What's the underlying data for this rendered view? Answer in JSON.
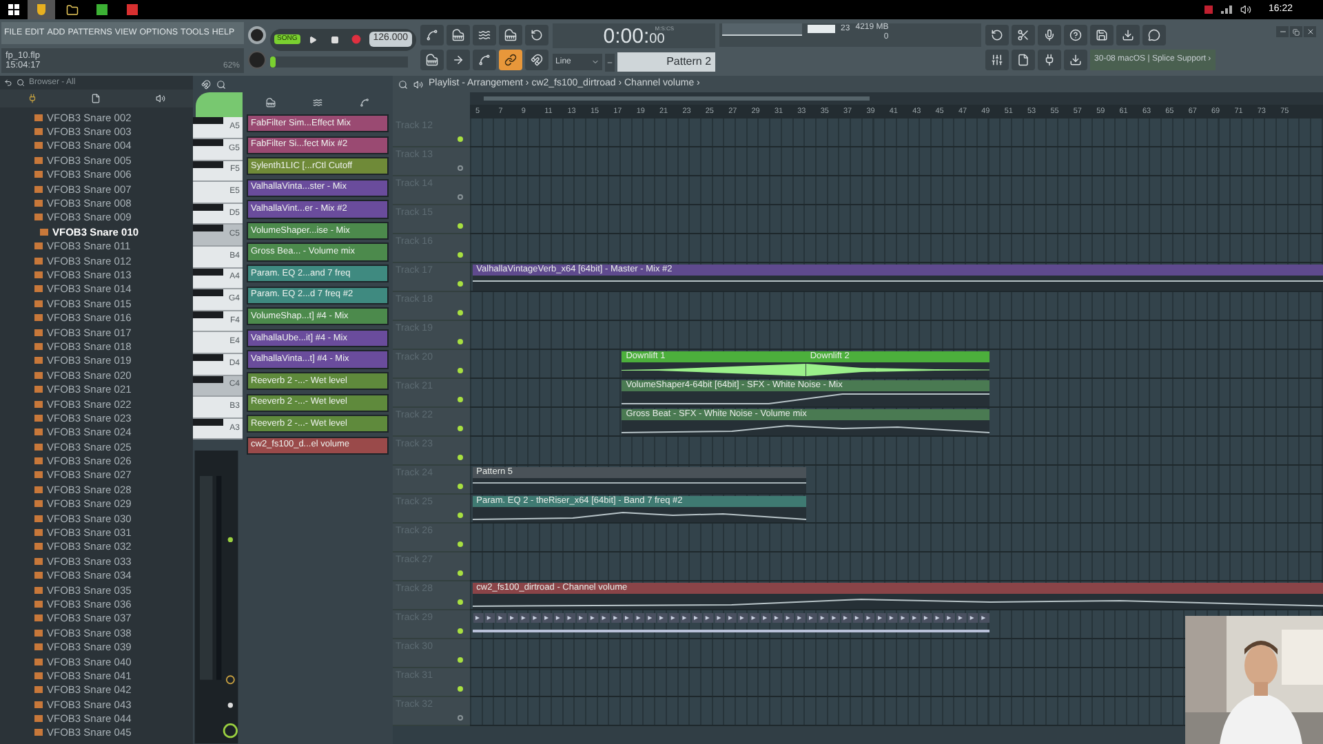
{
  "taskbar": {
    "clock": "16:22"
  },
  "menu": [
    "FILE",
    "EDIT",
    "ADD",
    "PATTERNS",
    "VIEW",
    "OPTIONS",
    "TOOLS",
    "HELP"
  ],
  "project": {
    "file": "fp_10.flp",
    "time": "15:04:17",
    "zoom": "62%"
  },
  "transport": {
    "mode": "SONG",
    "tempo": "126.000",
    "position": {
      "level": 0
    }
  },
  "clock_display": {
    "main": "0:00:",
    "sub": "00",
    "unit": "M:S:CS"
  },
  "monitor": {
    "cpu": "23",
    "memory": "4219 MB",
    "polyphony": "0"
  },
  "snap": "Line",
  "pattern": "Pattern 2",
  "news": "30-08  macOS | Splice Support ›",
  "browser": {
    "title": "Browser - All",
    "items": [
      {
        "label": "VFOB3 Snare 002",
        "selected": false
      },
      {
        "label": "VFOB3 Snare 003",
        "selected": false
      },
      {
        "label": "VFOB3 Snare 004",
        "selected": false
      },
      {
        "label": "VFOB3 Snare 005",
        "selected": false
      },
      {
        "label": "VFOB3 Snare 006",
        "selected": false
      },
      {
        "label": "VFOB3 Snare 007",
        "selected": false
      },
      {
        "label": "VFOB3 Snare 008",
        "selected": false
      },
      {
        "label": "VFOB3 Snare 009",
        "selected": false
      },
      {
        "label": "VFOB3 Snare 010",
        "selected": true
      },
      {
        "label": "VFOB3 Snare 011",
        "selected": false
      },
      {
        "label": "VFOB3 Snare 012",
        "selected": false
      },
      {
        "label": "VFOB3 Snare 013",
        "selected": false
      },
      {
        "label": "VFOB3 Snare 014",
        "selected": false
      },
      {
        "label": "VFOB3 Snare 015",
        "selected": false
      },
      {
        "label": "VFOB3 Snare 016",
        "selected": false
      },
      {
        "label": "VFOB3 Snare 017",
        "selected": false
      },
      {
        "label": "VFOB3 Snare 018",
        "selected": false
      },
      {
        "label": "VFOB3 Snare 019",
        "selected": false
      },
      {
        "label": "VFOB3 Snare 020",
        "selected": false
      },
      {
        "label": "VFOB3 Snare 021",
        "selected": false
      },
      {
        "label": "VFOB3 Snare 022",
        "selected": false
      },
      {
        "label": "VFOB3 Snare 023",
        "selected": false
      },
      {
        "label": "VFOB3 Snare 024",
        "selected": false
      },
      {
        "label": "VFOB3 Snare 025",
        "selected": false
      },
      {
        "label": "VFOB3 Snare 026",
        "selected": false
      },
      {
        "label": "VFOB3 Snare 027",
        "selected": false
      },
      {
        "label": "VFOB3 Snare 028",
        "selected": false
      },
      {
        "label": "VFOB3 Snare 029",
        "selected": false
      },
      {
        "label": "VFOB3 Snare 030",
        "selected": false
      },
      {
        "label": "VFOB3 Snare 031",
        "selected": false
      },
      {
        "label": "VFOB3 Snare 032",
        "selected": false
      },
      {
        "label": "VFOB3 Snare 033",
        "selected": false
      },
      {
        "label": "VFOB3 Snare 034",
        "selected": false
      },
      {
        "label": "VFOB3 Snare 035",
        "selected": false
      },
      {
        "label": "VFOB3 Snare 036",
        "selected": false
      },
      {
        "label": "VFOB3 Snare 037",
        "selected": false
      },
      {
        "label": "VFOB3 Snare 038",
        "selected": false
      },
      {
        "label": "VFOB3 Snare 039",
        "selected": false
      },
      {
        "label": "VFOB3 Snare 040",
        "selected": false
      },
      {
        "label": "VFOB3 Snare 041",
        "selected": false
      },
      {
        "label": "VFOB3 Snare 042",
        "selected": false
      },
      {
        "label": "VFOB3 Snare 043",
        "selected": false
      },
      {
        "label": "VFOB3 Snare 044",
        "selected": false
      },
      {
        "label": "VFOB3 Snare 045",
        "selected": false
      }
    ]
  },
  "piano_keys": [
    {
      "label": "A5",
      "sharp": true,
      "highlighted": false
    },
    {
      "label": "G5",
      "sharp": true,
      "highlighted": false
    },
    {
      "label": "F5",
      "sharp": true,
      "highlighted": false
    },
    {
      "label": "E5",
      "sharp": false,
      "highlighted": false
    },
    {
      "label": "D5",
      "sharp": true,
      "highlighted": false
    },
    {
      "label": "C5",
      "sharp": true,
      "highlighted": true
    },
    {
      "label": "B4",
      "sharp": false,
      "highlighted": false
    },
    {
      "label": "A4",
      "sharp": true,
      "highlighted": false
    },
    {
      "label": "G4",
      "sharp": true,
      "highlighted": false
    },
    {
      "label": "F4",
      "sharp": true,
      "highlighted": false
    },
    {
      "label": "E4",
      "sharp": false,
      "highlighted": false
    },
    {
      "label": "D4",
      "sharp": true,
      "highlighted": false
    },
    {
      "label": "C4",
      "sharp": true,
      "highlighted": true
    },
    {
      "label": "B3",
      "sharp": false,
      "highlighted": false
    },
    {
      "label": "A3",
      "sharp": true,
      "highlighted": false
    }
  ],
  "channels": [
    {
      "label": "FabFilter Sim...Effect Mix",
      "color": "#9a4a72"
    },
    {
      "label": "FabFilter Si...fect Mix #2",
      "color": "#9a4a72"
    },
    {
      "label": "Sylenth1LIC [...rCtl Cutoff",
      "color": "#6f8a38"
    },
    {
      "label": "ValhallaVinta...ster - Mix",
      "color": "#6a4c9c"
    },
    {
      "label": "ValhallaVint...er - Mix #2",
      "color": "#6a4c9c"
    },
    {
      "label": "VolumeShaper...ise - Mix",
      "color": "#4c8a4c"
    },
    {
      "label": "Gross Bea... - Volume mix",
      "color": "#4c8a4c"
    },
    {
      "label": "Param. EQ 2...and 7 freq",
      "color": "#3f8a80"
    },
    {
      "label": "Param. EQ 2...d 7 freq #2",
      "color": "#3f8a80"
    },
    {
      "label": "VolumeShap...t] #4 - Mix",
      "color": "#4c8a4c"
    },
    {
      "label": "ValhallaUbe...it] #4 - Mix",
      "color": "#6a4c9c"
    },
    {
      "label": "ValhallaVinta...t] #4 - Mix",
      "color": "#6a4c9c"
    },
    {
      "label": "Reeverb 2 -...- Wet level",
      "color": "#5f8a3c"
    },
    {
      "label": "Reeverb 2 -...- Wet level",
      "color": "#5f8a3c"
    },
    {
      "label": "Reeverb 2 -...- Wet level",
      "color": "#5f8a3c"
    },
    {
      "label": "cw2_fs100_d...el volume",
      "color": "#9a4a4a"
    }
  ],
  "playlist": {
    "title": "Playlist - Arrangement › cw2_fs100_dirtroad › Channel volume ›",
    "ruler": [
      "5",
      "7",
      "9",
      "11",
      "13",
      "15",
      "17",
      "19",
      "21",
      "23",
      "25",
      "27",
      "29",
      "31",
      "33",
      "35",
      "37",
      "39",
      "41",
      "43",
      "45",
      "47",
      "49",
      "51",
      "53",
      "55",
      "57",
      "59",
      "61",
      "63",
      "65",
      "67",
      "69",
      "71",
      "73",
      "75"
    ],
    "tracks": [
      {
        "name": "Track 12",
        "active": true
      },
      {
        "name": "Track 13",
        "active": false
      },
      {
        "name": "Track 14",
        "active": false
      },
      {
        "name": "Track 15",
        "active": true
      },
      {
        "name": "Track 16",
        "active": true
      },
      {
        "name": "Track 17",
        "active": true,
        "clips": [
          {
            "kind": "automation",
            "label": "ValhallaVintageVerb_x64 [64bit] - Master - Mix #2",
            "color": "#5f4a8e"
          }
        ]
      },
      {
        "name": "Track 18",
        "active": true
      },
      {
        "name": "Track 19",
        "active": true
      },
      {
        "name": "Track 20",
        "active": true,
        "clips": [
          {
            "kind": "audio",
            "label": "Downlift 1",
            "color": "#4caf3c"
          },
          {
            "kind": "audio",
            "label": "Downlift 2",
            "color": "#4caf3c"
          }
        ]
      },
      {
        "name": "Track 21",
        "active": true,
        "clips": [
          {
            "kind": "automation",
            "label": "VolumeShaper4-64bit [64bit] - SFX - White Noise - Mix",
            "color": "#4a7a52"
          }
        ]
      },
      {
        "name": "Track 22",
        "active": true,
        "clips": [
          {
            "kind": "automation",
            "label": "Gross Beat - SFX - White Noise - Volume mix",
            "color": "#4a7a52"
          }
        ]
      },
      {
        "name": "Track 23",
        "active": true
      },
      {
        "name": "Track 24",
        "active": true,
        "clips": [
          {
            "kind": "pattern",
            "label": "Pattern 5",
            "color": "#4a5258"
          }
        ]
      },
      {
        "name": "Track 25",
        "active": true,
        "clips": [
          {
            "kind": "automation",
            "label": "Param. EQ 2 - theRiser_x64 [64bit] - Band 7 freq #2",
            "color": "#3f7a72"
          }
        ]
      },
      {
        "name": "Track 26",
        "active": true
      },
      {
        "name": "Track 27",
        "active": true
      },
      {
        "name": "Track 28",
        "active": true,
        "clips": [
          {
            "kind": "automation",
            "label": "cw2_fs100_dirtroad - Channel volume",
            "color": "#8a4448"
          }
        ]
      },
      {
        "name": "Track 29",
        "active": true,
        "clips": [
          {
            "kind": "pattern_strip",
            "color": "#4a5060"
          }
        ]
      },
      {
        "name": "Track 30",
        "active": true
      },
      {
        "name": "Track 31",
        "active": true
      },
      {
        "name": "Track 32",
        "active": false
      }
    ]
  }
}
